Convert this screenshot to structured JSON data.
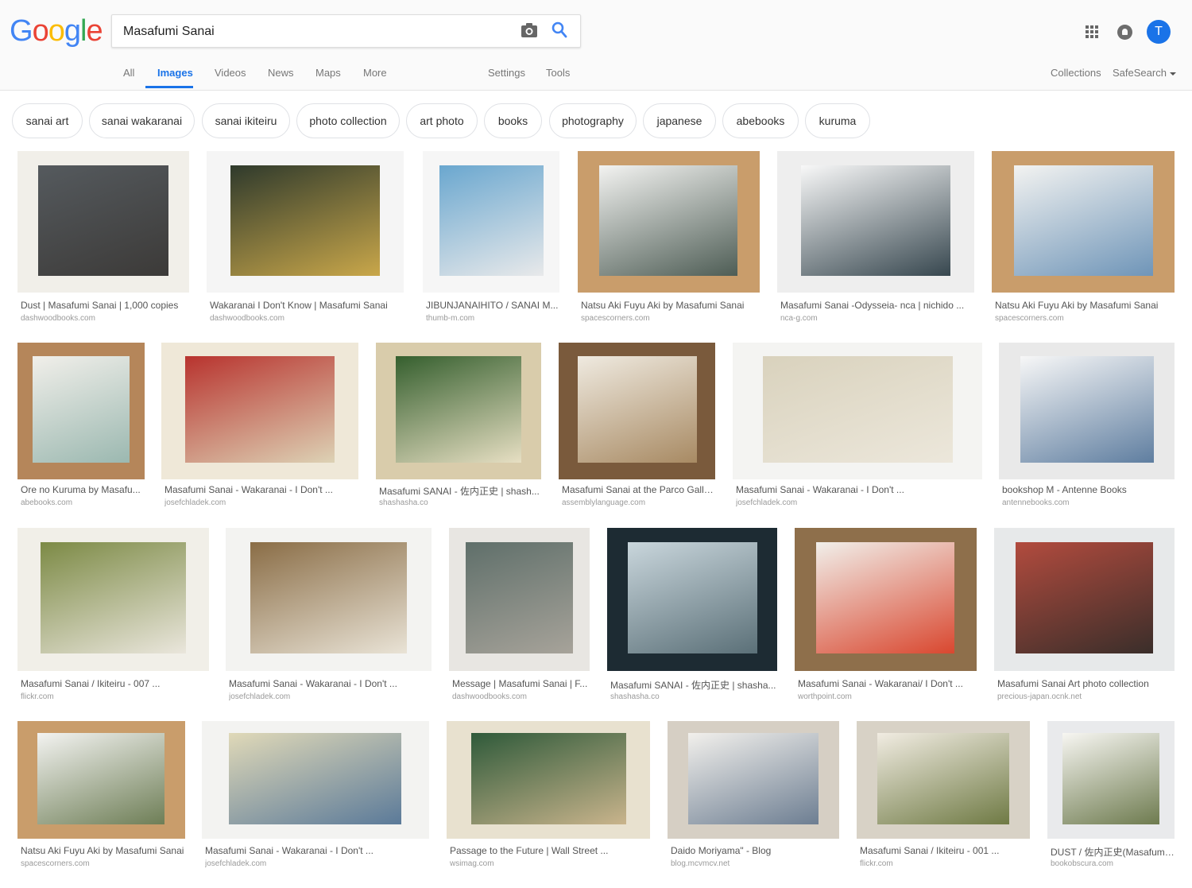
{
  "logo": {
    "letters": [
      "G",
      "o",
      "o",
      "g",
      "l",
      "e"
    ],
    "colors": [
      "#4285f4",
      "#ea4335",
      "#fbbc05",
      "#4285f4",
      "#34a853",
      "#ea4335"
    ]
  },
  "search": {
    "value": "Masafumi Sanai"
  },
  "icons": {
    "camera": "camera-icon",
    "search": "search-icon",
    "apps": "apps-grid-icon",
    "notifications": "notifications-icon"
  },
  "account": {
    "initial": "T",
    "color": "#1a73e8"
  },
  "nav": {
    "tabs": [
      "All",
      "Images",
      "Videos",
      "News",
      "Maps",
      "More"
    ],
    "active_tab": "Images",
    "settings": "Settings",
    "tools": "Tools",
    "collections": "Collections",
    "safesearch": "SafeSearch"
  },
  "chips": [
    "sanai art",
    "sanai wakaranai",
    "sanai ikiteiru",
    "photo collection",
    "art photo",
    "books",
    "photography",
    "japanese",
    "abebooks",
    "kuruma"
  ],
  "results": [
    {
      "title": "Dust | Masafumi Sanai | 1,000 copies",
      "source": "dashwoodbooks.com"
    },
    {
      "title": "Wakaranai I Don't Know | Masafumi Sanai",
      "source": "dashwoodbooks.com"
    },
    {
      "title": "JIBUNJANAIHITO / SANAI M...",
      "source": "thumb-m.com"
    },
    {
      "title": "Natsu Aki Fuyu Aki by Masafumi Sanai",
      "source": "spacescorners.com"
    },
    {
      "title": "Masafumi Sanai -Odysseia- nca | nichido ...",
      "source": "nca-g.com"
    },
    {
      "title": "Natsu Aki Fuyu Aki by Masafumi Sanai",
      "source": "spacescorners.com"
    },
    {
      "title": "Ore no Kuruma by Masafu...",
      "source": "abebooks.com"
    },
    {
      "title": "Masafumi Sanai - Wakaranai - I Don't ...",
      "source": "josefchladek.com"
    },
    {
      "title": "Masafumi SANAI - 佐内正史 | shash...",
      "source": "shashasha.co"
    },
    {
      "title": "Masafumi Sanai at the Parco Gallery",
      "source": "assemblylanguage.com"
    },
    {
      "title": "Masafumi Sanai - Wakaranai - I Don't ...",
      "source": "josefchladek.com"
    },
    {
      "title": "bookshop M - Antenne Books",
      "source": "antennebooks.com"
    },
    {
      "title": "Masafumi Sanai / Ikiteiru - 007 ...",
      "source": "flickr.com"
    },
    {
      "title": "Masafumi Sanai - Wakaranai - I Don't ...",
      "source": "josefchladek.com"
    },
    {
      "title": "Message | Masafumi Sanai | F...",
      "source": "dashwoodbooks.com"
    },
    {
      "title": "Masafumi SANAI - 佐内正史 | shasha...",
      "source": "shashasha.co"
    },
    {
      "title": "Masafumi Sanai - Wakaranai/ I Don't ...",
      "source": "worthpoint.com"
    },
    {
      "title": "Masafumi Sanai Art photo collection",
      "source": "precious-japan.ocnk.net"
    },
    {
      "title": "Natsu Aki Fuyu Aki by Masafumi Sanai",
      "source": "spacescorners.com"
    },
    {
      "title": "Masafumi Sanai - Wakaranai - I Don't ...",
      "source": "josefchladek.com"
    },
    {
      "title": "Passage to the Future | Wall Street ...",
      "source": "wsimag.com"
    },
    {
      "title": "Daido Moriyama\" - Blog",
      "source": "blog.mcvmcv.net"
    },
    {
      "title": "Masafumi Sanai / Ikiteiru - 001 ...",
      "source": "flickr.com"
    },
    {
      "title": "DUST / 佐内正史(Masafumi...",
      "source": "bookobscura.com"
    }
  ],
  "thumb_palettes": [
    [
      "#f1efe9",
      "#555a5e",
      "#3c3a38"
    ],
    [
      "#f5f5f5",
      "#2f3a2c",
      "#c9a74a"
    ],
    [
      "#f6f6f6",
      "#6aa7cf",
      "#e8e9ea"
    ],
    [
      "#c99d6b",
      "#f3f3f1",
      "#4e5d55"
    ],
    [
      "#eeeeee",
      "#f8f8f8",
      "#37474f"
    ],
    [
      "#c99d6b",
      "#f3f3f1",
      "#6f95b8"
    ],
    [
      "#b5865a",
      "#f1efea",
      "#9bb8b0"
    ],
    [
      "#efe8d8",
      "#b8332e",
      "#ddd2b5"
    ],
    [
      "#d9ccab",
      "#355f2e",
      "#e7dfc3"
    ],
    [
      "#7a5a3c",
      "#efeae0",
      "#a88a63"
    ],
    [
      "#f4f4f2",
      "#d9d2bd",
      "#ece7db"
    ],
    [
      "#e9e9e9",
      "#f7f7f7",
      "#5f7ea0"
    ],
    [
      "#f1efe8",
      "#7c8a45",
      "#eae6dc"
    ],
    [
      "#f3f3f1",
      "#8a6d46",
      "#e9e3d6"
    ],
    [
      "#e8e6e2",
      "#5f6f6a",
      "#a7a39a"
    ],
    [
      "#1d2b33",
      "#c9d6dc",
      "#5b7078"
    ],
    [
      "#8e6f4b",
      "#f1efea",
      "#d9472f"
    ],
    [
      "#e7e9ea",
      "#b24b3e",
      "#3a2e2a"
    ],
    [
      "#c99d6b",
      "#f3f3f1",
      "#6e7e56"
    ],
    [
      "#f3f3f1",
      "#e0d9b8",
      "#5b7a99"
    ],
    [
      "#e8e1cf",
      "#2f5a3a",
      "#c9b48c"
    ],
    [
      "#d6cfc4",
      "#f2f0ec",
      "#6d7e92"
    ],
    [
      "#d8d2c6",
      "#f1ece2",
      "#6f7a44"
    ],
    [
      "#e9eaec",
      "#f7f6f2",
      "#6e7b4f"
    ]
  ]
}
